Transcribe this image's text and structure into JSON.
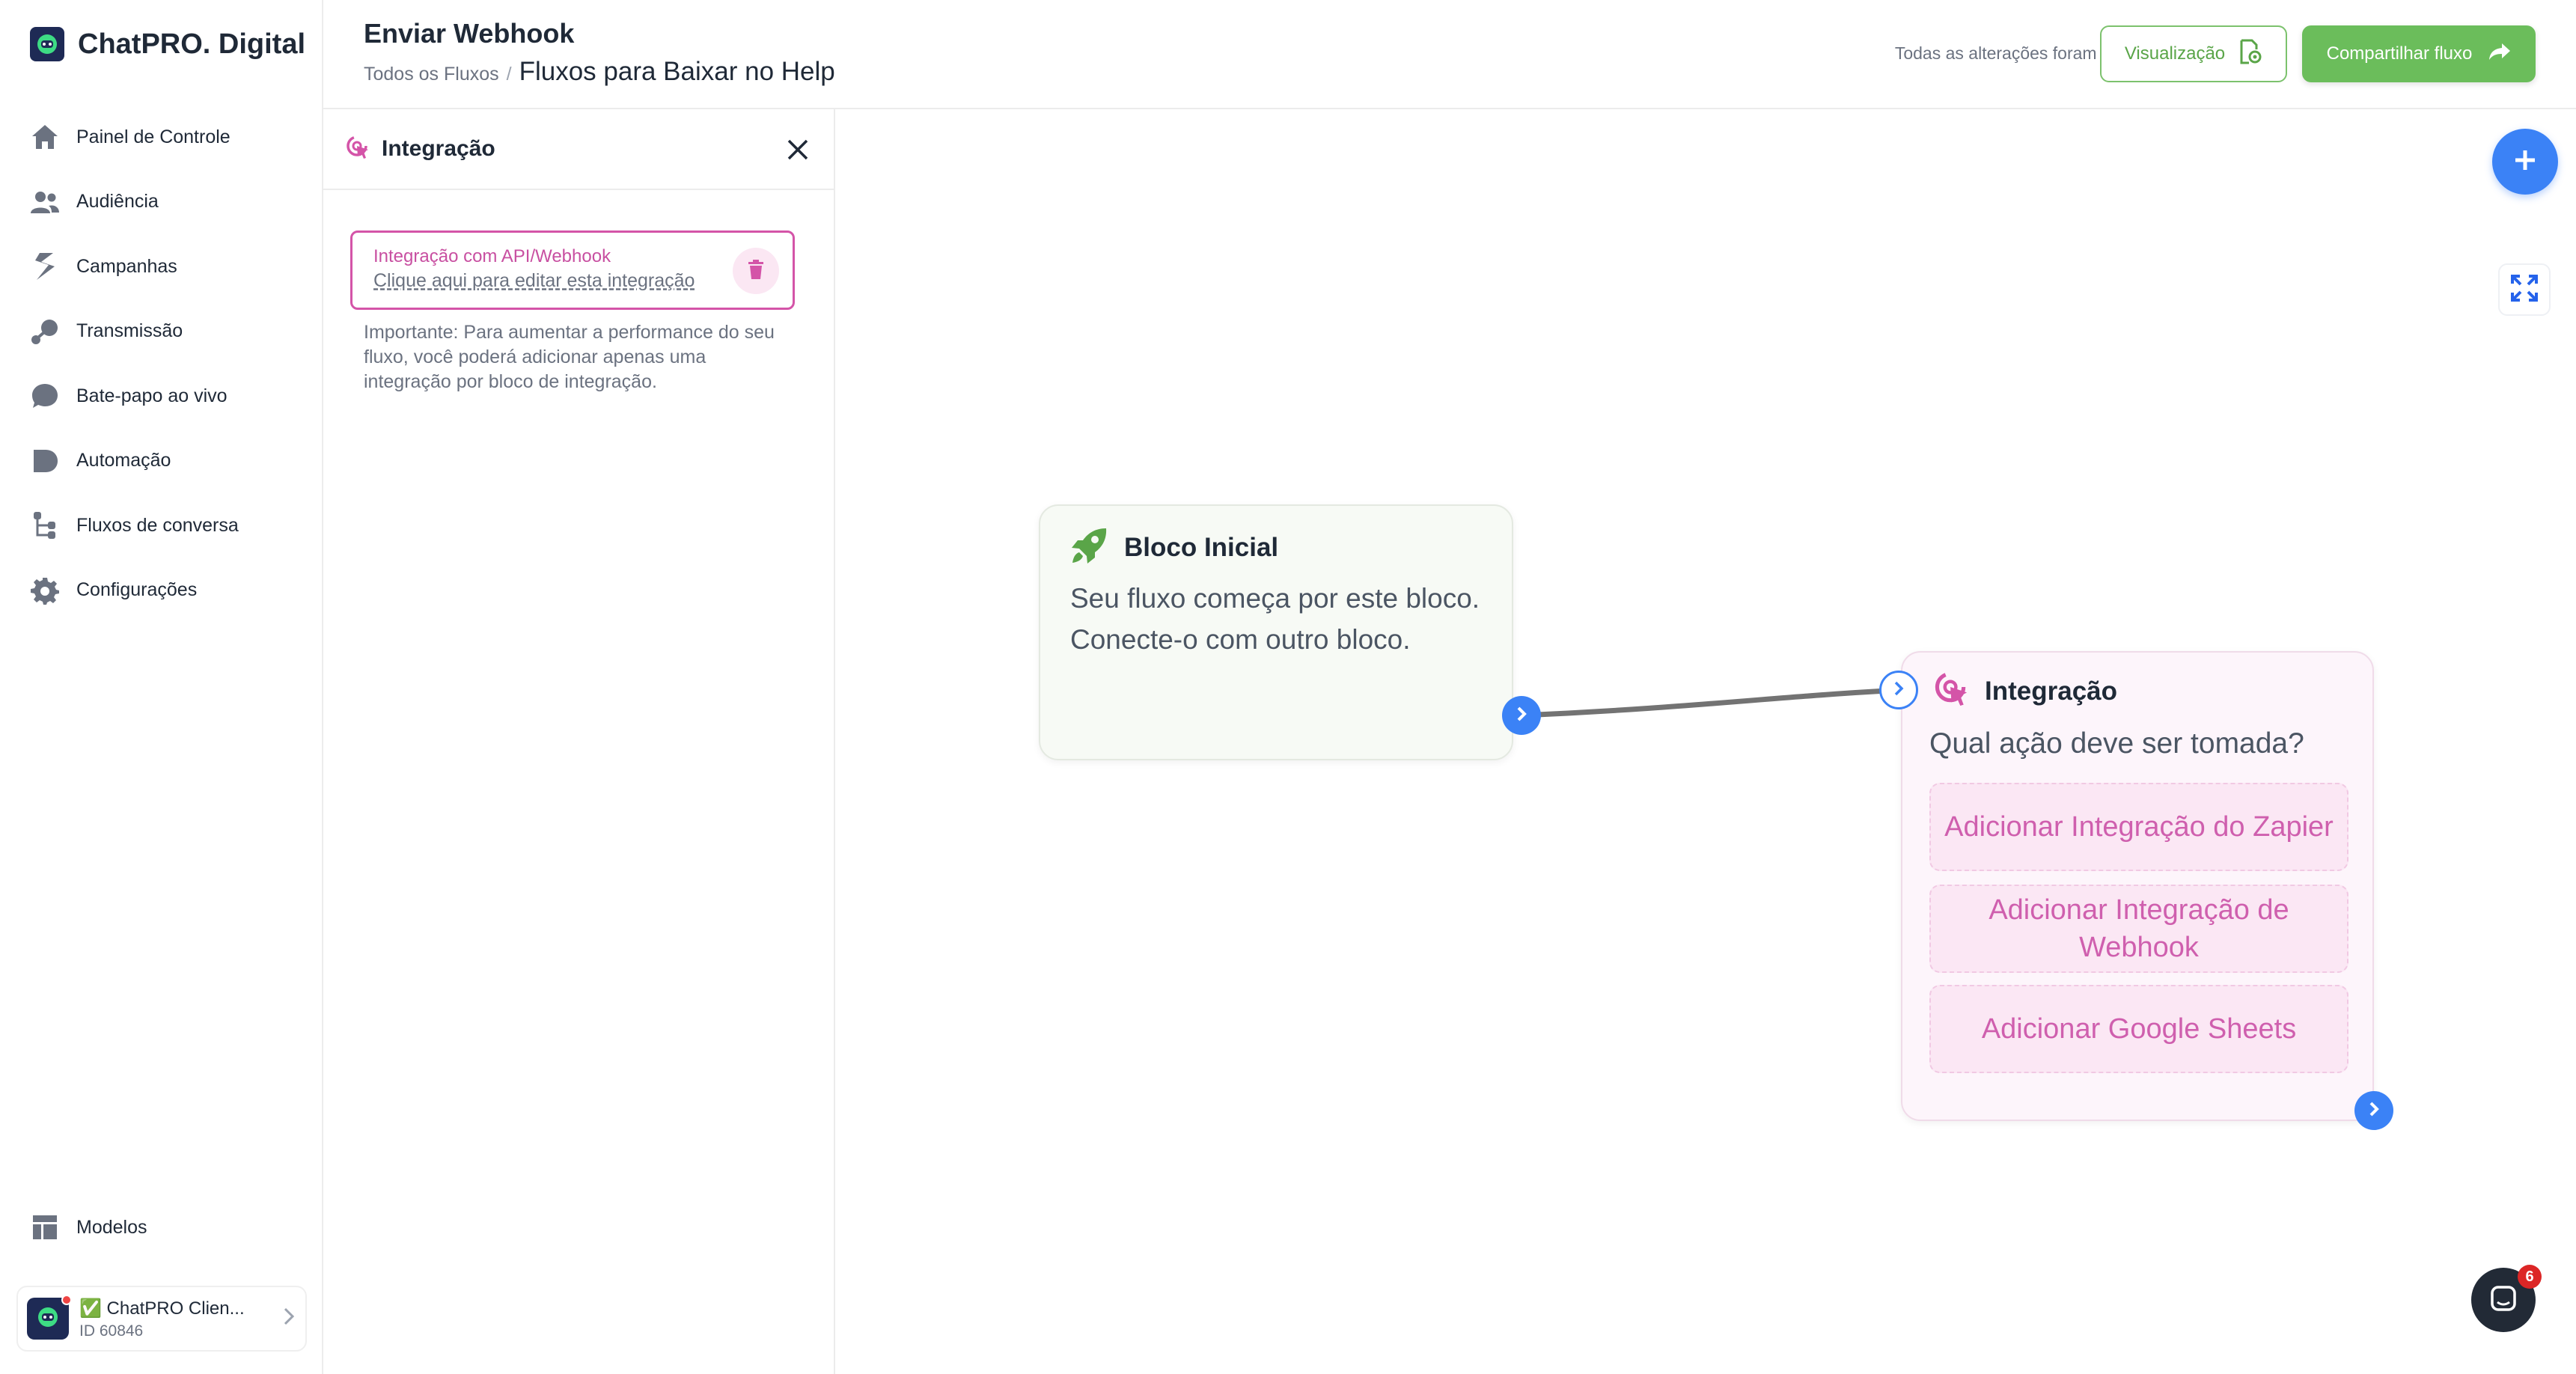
{
  "brand": {
    "name": "ChatPRO. Digital"
  },
  "sidebar": {
    "items": [
      {
        "label": "Painel de Controle",
        "icon": "home-icon"
      },
      {
        "label": "Audiência",
        "icon": "users-icon"
      },
      {
        "label": "Campanhas",
        "icon": "campaign-icon"
      },
      {
        "label": "Transmissão",
        "icon": "broadcast-icon"
      },
      {
        "label": "Bate-papo ao vivo",
        "icon": "chat-bubble-icon"
      },
      {
        "label": "Automação",
        "icon": "automation-icon"
      },
      {
        "label": "Fluxos de conversa",
        "icon": "flow-icon"
      },
      {
        "label": "Configurações",
        "icon": "gear-icon"
      }
    ],
    "bottom": {
      "label": "Modelos",
      "icon": "templates-icon"
    },
    "account": {
      "name": "✅ ChatPRO Clien...",
      "id": "ID 60846"
    }
  },
  "header": {
    "title": "Enviar Webhook",
    "breadcrumb_root": "Todos os Fluxos",
    "breadcrumb_sep": "/",
    "breadcrumb_current": "Fluxos para Baixar no Help",
    "autosave": "Todas as alterações foram salvas automaticamente",
    "preview_label": "Visualização",
    "share_label": "Compartilhar fluxo"
  },
  "panel": {
    "title": "Integração",
    "card_title": "Integração com API/Webhook",
    "card_link": "Clique aqui para editar esta integração",
    "note": "Importante: Para aumentar a performance do seu fluxo, você poderá adicionar apenas uma integração por bloco de integração."
  },
  "canvas": {
    "start_node": {
      "title": "Bloco Inicial",
      "text": "Seu fluxo começa por este bloco. Conecte-o com outro bloco."
    },
    "integration_node": {
      "title": "Integração",
      "question": "Qual ação deve ser tomada?",
      "actions": [
        "Adicionar Integração do Zapier",
        "Adicionar Integração de Webhook",
        "Adicionar Google Sheets"
      ]
    }
  },
  "chat_widget": {
    "badge": "6"
  },
  "colors": {
    "primary_blue": "#3b82f6",
    "brand_green": "#6bbd5b",
    "integration_pink": "#d454a8",
    "dark_navy": "#1e2a55"
  }
}
